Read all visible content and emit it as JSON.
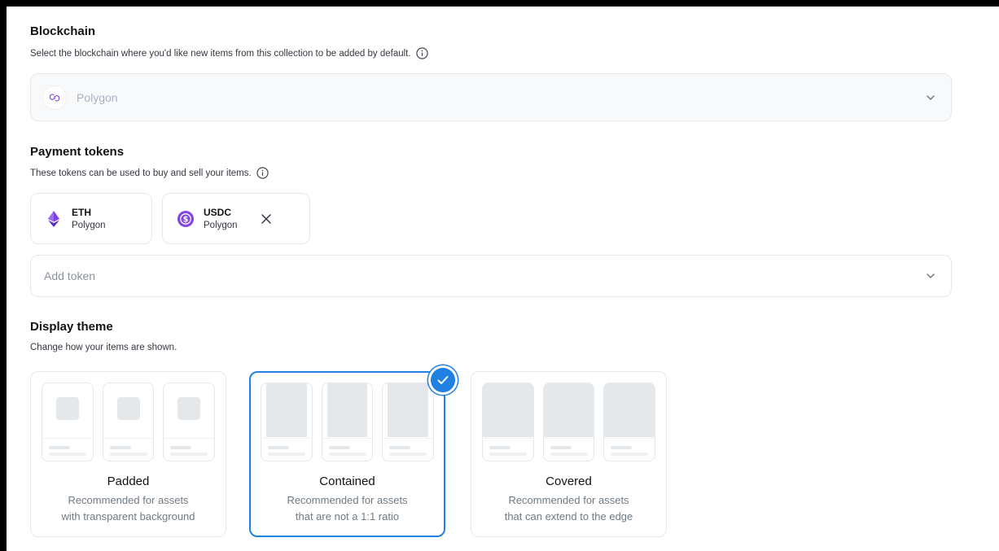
{
  "blockchain": {
    "title": "Blockchain",
    "description": "Select the blockchain where you'd like new items from this collection to be added by default.",
    "selected_value": "Polygon",
    "chain_icon": "polygon-icon"
  },
  "payment_tokens": {
    "title": "Payment tokens",
    "description": "These tokens can be used to buy and sell your items.",
    "tokens": [
      {
        "symbol": "ETH",
        "network": "Polygon",
        "icon": "ethereum-icon",
        "color": "#7b3fe4",
        "removable": false
      },
      {
        "symbol": "USDC",
        "network": "Polygon",
        "icon": "usdc-icon",
        "color": "#8247e5",
        "removable": true
      }
    ],
    "add_token_placeholder": "Add token"
  },
  "display_theme": {
    "title": "Display theme",
    "description": "Change how your items are shown.",
    "options": [
      {
        "name": "Padded",
        "desc_line1": "Recommended for assets",
        "desc_line2": "with transparent background",
        "selected": false
      },
      {
        "name": "Contained",
        "desc_line1": "Recommended for assets",
        "desc_line2": "that are not a 1:1 ratio",
        "selected": true
      },
      {
        "name": "Covered",
        "desc_line1": "Recommended for assets",
        "desc_line2": "that can extend to the edge",
        "selected": false
      }
    ]
  },
  "colors": {
    "accent": "#2081e2",
    "border": "#e5e8eb",
    "muted_text": "#707a83"
  }
}
